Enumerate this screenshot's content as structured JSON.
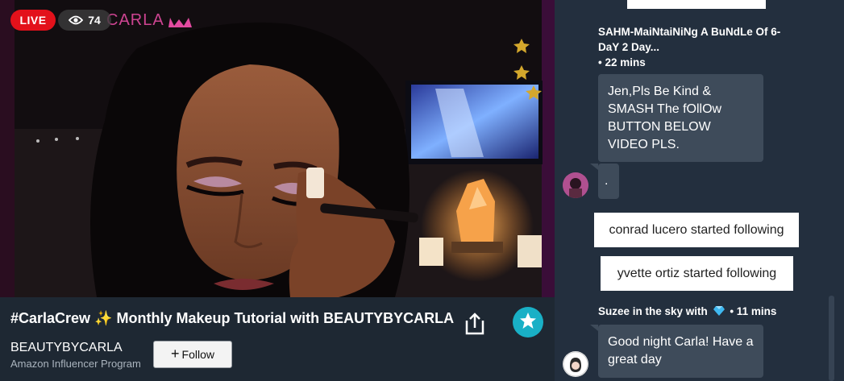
{
  "video": {
    "live_label": "LIVE",
    "viewer_count": "74",
    "watermark": "CARLA",
    "icons": [
      "eye-icon",
      "crown-icon",
      "star-icon"
    ]
  },
  "stream": {
    "title": "#CarlaCrew ✨ Monthly Makeup Tutorial with BEAUTYBYCARLA",
    "channel_name": "BEAUTYBYCARLA",
    "channel_subtitle": "Amazon Influencer Program",
    "follow_label": "Follow",
    "icons": [
      "share-icon",
      "star-icon",
      "plus-icon"
    ]
  },
  "chat": {
    "messages": [
      {
        "author": "SAHM-MaiNtaiNiNg A BuNdLe Of 6-DaY 2 Day...",
        "time": "• 22 mins",
        "text": "Jen,Pls Be Kind & SMASH The fOllOw BUTTON BELOW VIDEO PLS."
      },
      {
        "text": "."
      },
      {
        "author": "Suzee in the sky with",
        "author_icon": "diamond-icon",
        "time": "• 11 mins",
        "text": "Good night Carla! Have a great day"
      }
    ],
    "notices": [
      "conrad lucero started following",
      "yvette ortiz started following"
    ]
  },
  "colors": {
    "live_red": "#e3111b",
    "accent_teal": "#19b0c6",
    "chat_bg": "#232f3e",
    "bubble_bg": "#3e4b5a"
  }
}
